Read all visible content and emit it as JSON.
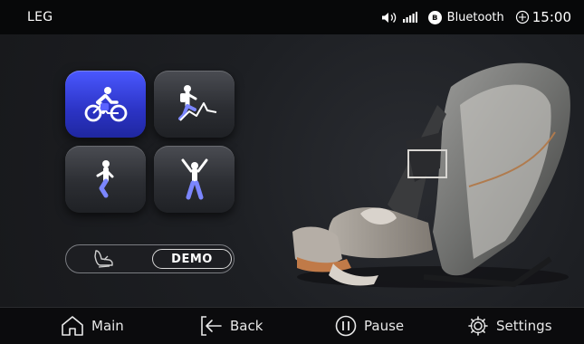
{
  "status_bar": {
    "page_label": "LEG",
    "bluetooth_label": "Bluetooth",
    "time": "15:00",
    "icons": [
      "volume-icon",
      "signal-icon",
      "bluetooth-icon",
      "clock-icon"
    ]
  },
  "modes": [
    {
      "name": "cycling-mode",
      "icon": "cyclist-icon",
      "active": true
    },
    {
      "name": "climbing-mode",
      "icon": "climber-icon",
      "active": false
    },
    {
      "name": "leg-stretch-mode",
      "icon": "leg-stretch-icon",
      "active": false
    },
    {
      "name": "full-stretch-mode",
      "icon": "full-stretch-icon",
      "active": false
    }
  ],
  "demo": {
    "label": "DEMO",
    "icon": "chair-outline-icon"
  },
  "nav": {
    "main_label": "Main",
    "back_label": "Back",
    "pause_label": "Pause",
    "settings_label": "Settings"
  },
  "colors": {
    "accent": "#3845e0",
    "background": "#1b1c1f",
    "bar": "#070809"
  }
}
